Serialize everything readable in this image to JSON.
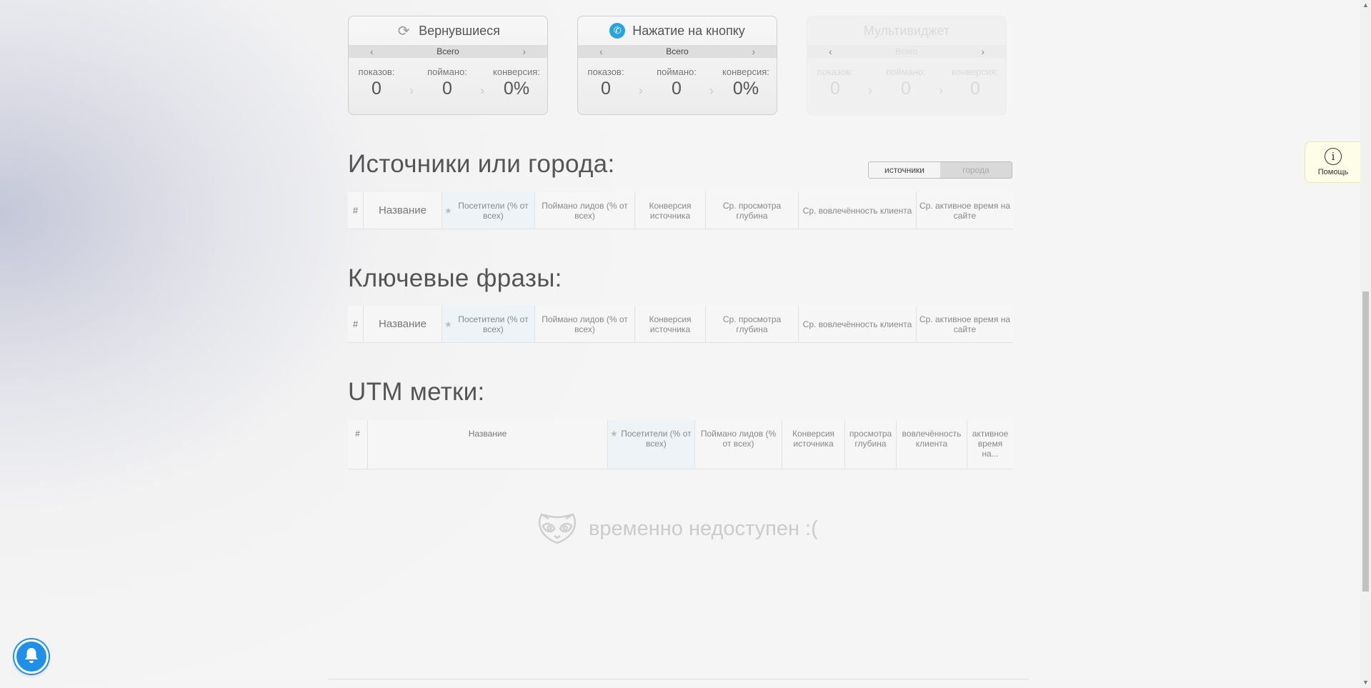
{
  "widgets": [
    {
      "title": "Вернувшиеся",
      "icon": "refresh-icon",
      "period": "Всего",
      "shows_label": "показов:",
      "caught_label": "поймано:",
      "conv_label": "конверсия:",
      "shows": "0",
      "caught": "0",
      "conv": "0%"
    },
    {
      "title": "Нажатие на кнопку",
      "icon": "phone-icon",
      "period": "Всего",
      "shows_label": "показов:",
      "caught_label": "поймано:",
      "conv_label": "конверсия:",
      "shows": "0",
      "caught": "0",
      "conv": "0%"
    },
    {
      "title": "Мультивиджет",
      "period": "Всего",
      "shows_label": "показов:",
      "caught_label": "поймано:",
      "conv_label": "конверсия:",
      "shows": "0",
      "caught": "0",
      "conv": "0"
    }
  ],
  "sources": {
    "title": "Источники или города:",
    "toggle": {
      "active": "источники",
      "inactive": "города"
    },
    "columns": [
      "#",
      "Название",
      "Посетители (% от всех)",
      "Поймано лидов (% от всех)",
      "Конверсия источника",
      "Ср. просмотра глубина",
      "Ср. вовлечённость клиента",
      "Ср. активное время на сайте"
    ]
  },
  "keywords": {
    "title": "Ключевые фразы:",
    "columns": [
      "#",
      "Название",
      "Посетители (% от всех)",
      "Поймано лидов (% от всех)",
      "Конверсия источника",
      "Ср. просмотра глубина",
      "Ср. вовлечённость клиента",
      "Ср. активное время на сайте"
    ]
  },
  "utm": {
    "title": "UTM метки:",
    "columns": [
      "#",
      "Название",
      "Посетители (% от всех)",
      "Поймано лидов (% от всех)",
      "Конверсия источника",
      "просмотра глубина",
      "вовлечённость клиента",
      "активное время на..."
    ]
  },
  "unavailable_text": "временно недоступен :(",
  "help_label": "Помощь",
  "colors": {
    "accent": "#1e90e8",
    "phone": "#29a2e0",
    "help_bg": "#fdfde8"
  }
}
